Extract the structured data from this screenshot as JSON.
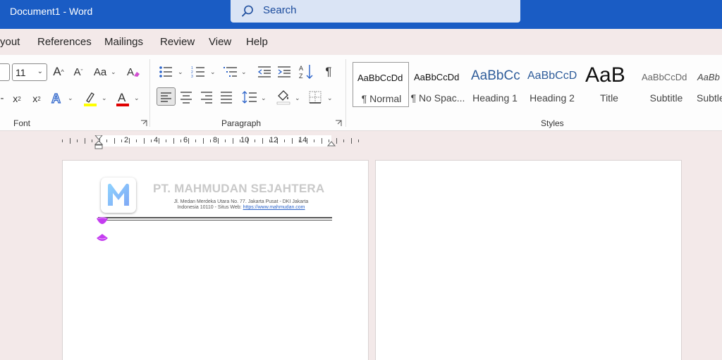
{
  "window": {
    "title": "Document1  -  Word"
  },
  "search": {
    "label": "Search"
  },
  "menu": {
    "tabs": [
      "yout",
      "References",
      "Mailings",
      "Review",
      "View",
      "Help"
    ]
  },
  "ribbon": {
    "font": {
      "group_label": "Font",
      "size_value": "11",
      "change_case_label": "Aa"
    },
    "paragraph": {
      "group_label": "Paragraph"
    },
    "styles": {
      "group_label": "Styles",
      "items": [
        {
          "preview": "AaBbCcDd",
          "name": "¶ Normal"
        },
        {
          "preview": "AaBbCcDd",
          "name": "¶ No Spac..."
        },
        {
          "preview": "AaBbCc",
          "name": "Heading 1"
        },
        {
          "preview": "AaBbCcD",
          "name": "Heading 2"
        },
        {
          "preview": "AaB",
          "name": "Title"
        },
        {
          "preview": "AaBbCcDd",
          "name": "Subtitle"
        },
        {
          "preview": "AaBb",
          "name": "Subtle"
        }
      ]
    },
    "colors": {
      "highlight": "#ffff00",
      "font_color": "#e00000",
      "accent": "#1a5cc4"
    }
  },
  "ruler": {
    "numbers": [
      "2",
      "4",
      "6",
      "8",
      "10",
      "12",
      "14"
    ]
  },
  "document": {
    "company_name": "PT. MAHMUDAN SEJAHTERA",
    "address_line1": "Jl. Medan Merdeka Utara No. 77. Jakarta Pusat - DKI Jakarta",
    "address_line2_prefix": "Indonesia 10110 - Situs Web: ",
    "website": "https://www.mahmudan.com"
  }
}
